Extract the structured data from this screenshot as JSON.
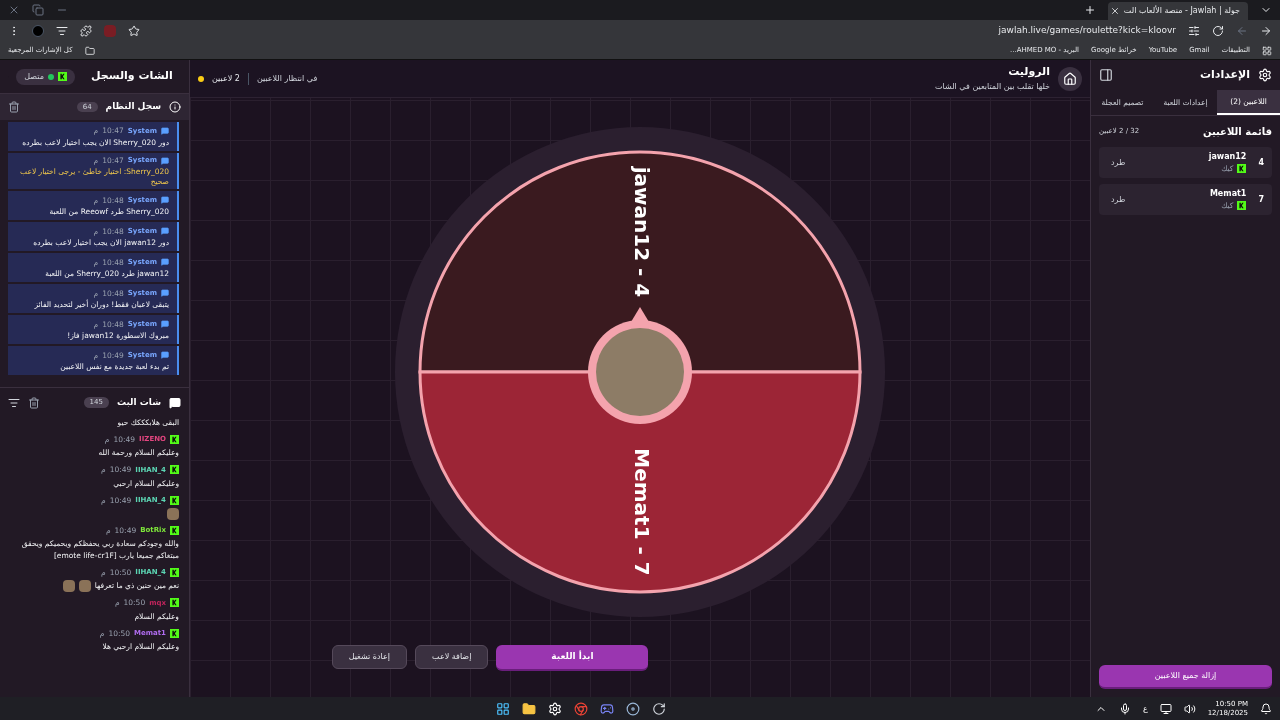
{
  "browser": {
    "tab_title": "جولة | Jawlah - منصة الألعاب الت",
    "url": "jawlah.live/games/roulette?kick=kloovr",
    "bookmarks": [
      "التطبيقات",
      "Gmail",
      "YouTube",
      "خرائط Google",
      "البريد - AHMED MO..."
    ],
    "all_bookmarks": "كل الإشارات المرجعية"
  },
  "chat_panel": {
    "title": "الشات والسجل",
    "status": "متصل",
    "system_log": {
      "title": "سجل النظام",
      "count": "64",
      "entries": [
        {
          "user": "System",
          "time": "10:47",
          "period": "م",
          "text": "دور Sherry_020 الان يجب اختيار لاعب بطرده",
          "kind": "info"
        },
        {
          "user": "System",
          "time": "10:47",
          "period": "م",
          "text": "Sherry_020: اختيار خاطئ - يرجى اختيار لاعب صحيح",
          "kind": "warning"
        },
        {
          "user": "System",
          "time": "10:48",
          "period": "م",
          "text": "Sherry_020 طرد Reeowf من اللعبة",
          "kind": "info"
        },
        {
          "user": "System",
          "time": "10:48",
          "period": "م",
          "text": "دور jawan12 الان يجب اختيار لاعب بطرده",
          "kind": "info"
        },
        {
          "user": "System",
          "time": "10:48",
          "period": "م",
          "text": "jawan12 طرد Sherry_020 من اللعبة",
          "kind": "info"
        },
        {
          "user": "System",
          "time": "10:48",
          "period": "م",
          "text": "يتبقى لاعبان فقط! دوران أخير لتحديد الفائز",
          "kind": "info"
        },
        {
          "user": "System",
          "time": "10:48",
          "period": "م",
          "text": "مبروك الاسطورة jawan12 فاز!",
          "kind": "info"
        },
        {
          "user": "System",
          "time": "10:49",
          "period": "م",
          "text": "تم بدء لعبة جديدة مع نفس اللاعبين",
          "kind": "info"
        }
      ]
    },
    "stream_chat": {
      "title": "شات البث",
      "count": "145",
      "messages": [
        {
          "text": "البقى هلابكككك حيو"
        },
        {
          "user": "IIZENO",
          "color": "#e2457f",
          "time": "10:49",
          "period": "م",
          "text": "وعليكم السلام ورحمة الله"
        },
        {
          "user": "IIHAN_4",
          "color": "#5cd6b4",
          "time": "10:49",
          "period": "م",
          "text": "وعليكم السلام ارحبي"
        },
        {
          "user": "IIHAN_4",
          "color": "#5cd6b4",
          "time": "10:49",
          "period": "م",
          "attachments": [
            {
              "kind": "emote"
            }
          ]
        },
        {
          "user": "BotRix",
          "color": "#7ee83a",
          "time": "10:49",
          "period": "م",
          "text": "والله وجودكم سعادة ربي يحفظكم ويحميكم ويحقق مبتغاكم جميعا يارب [emote life-cr1F]"
        },
        {
          "user": "IIHAN_4",
          "color": "#5cd6b4",
          "time": "10:50",
          "period": "م",
          "text": "نعم مين حنين ذي ما تعرفها",
          "attachments": [
            {
              "kind": "emote"
            },
            {
              "kind": "emote"
            }
          ]
        },
        {
          "user": "mqx",
          "color": "#c2245c",
          "time": "10:50",
          "period": "م",
          "text": "وعليكم السلام"
        },
        {
          "user": "Memat1",
          "color": "#b06cf0",
          "time": "10:50",
          "period": "م",
          "text": "وعليكم السلام ارحبي هلا"
        }
      ]
    }
  },
  "game": {
    "title": "الروليت",
    "subtitle": "خلها تقلب بين المتابعين في الشات",
    "players_count": "2 لاعبين",
    "status": "في انتظار اللاعبين",
    "wheel": {
      "segments": [
        {
          "label": "jawan12 - 4",
          "color": "#3a1a1f"
        },
        {
          "label": "Memat1 - 7",
          "color": "#9c2536"
        }
      ]
    },
    "buttons": [
      {
        "label": "ابدأ اللعبة",
        "kind": "primary"
      },
      {
        "label": "إضافة لاعب",
        "kind": "secondary"
      },
      {
        "label": "إعادة تشغيل",
        "kind": "secondary"
      }
    ]
  },
  "settings": {
    "title": "الإعدادات",
    "tabs": [
      {
        "label": "اللاعبين (2)",
        "selected": true
      },
      {
        "label": "إعدادات اللعبة",
        "selected": false
      },
      {
        "label": "تصميم العجلة",
        "selected": false
      }
    ],
    "list_title": "قائمة اللاعبين",
    "list_count": "32 / 2 لاعبين",
    "players": [
      {
        "number": "4",
        "name": "jawan12",
        "platform": "كيك",
        "action": "طرد"
      },
      {
        "number": "7",
        "name": "Memat1",
        "platform": "كيك",
        "action": "طرد"
      }
    ],
    "remove_all": "إزالة جميع اللاعبين"
  },
  "taskbar": {
    "language": "ع",
    "time": "10:50 PM",
    "date": "12/18/2025"
  }
}
